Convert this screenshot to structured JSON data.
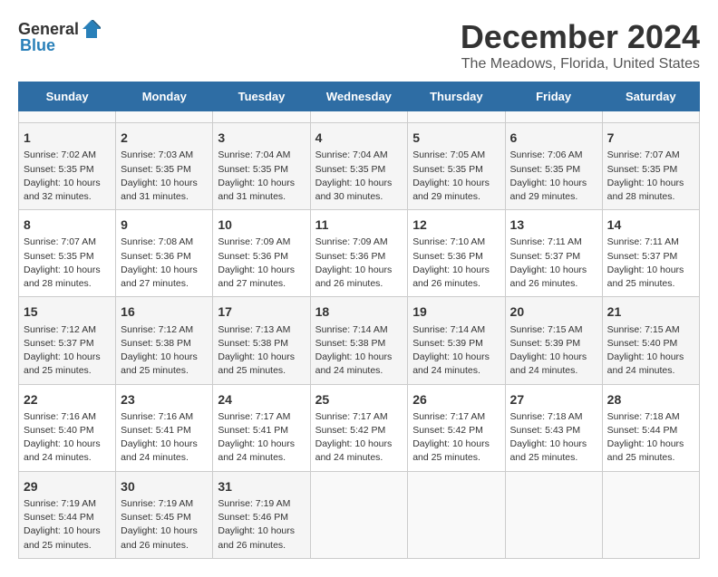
{
  "header": {
    "logo_general": "General",
    "logo_blue": "Blue",
    "title": "December 2024",
    "subtitle": "The Meadows, Florida, United States"
  },
  "calendar": {
    "days_of_week": [
      "Sunday",
      "Monday",
      "Tuesday",
      "Wednesday",
      "Thursday",
      "Friday",
      "Saturday"
    ],
    "weeks": [
      [
        {
          "day": "",
          "empty": true
        },
        {
          "day": "",
          "empty": true
        },
        {
          "day": "",
          "empty": true
        },
        {
          "day": "",
          "empty": true
        },
        {
          "day": "",
          "empty": true
        },
        {
          "day": "",
          "empty": true
        },
        {
          "day": "",
          "empty": true
        }
      ],
      [
        {
          "day": "1",
          "sunrise": "Sunrise: 7:02 AM",
          "sunset": "Sunset: 5:35 PM",
          "daylight": "Daylight: 10 hours and 32 minutes."
        },
        {
          "day": "2",
          "sunrise": "Sunrise: 7:03 AM",
          "sunset": "Sunset: 5:35 PM",
          "daylight": "Daylight: 10 hours and 31 minutes."
        },
        {
          "day": "3",
          "sunrise": "Sunrise: 7:04 AM",
          "sunset": "Sunset: 5:35 PM",
          "daylight": "Daylight: 10 hours and 31 minutes."
        },
        {
          "day": "4",
          "sunrise": "Sunrise: 7:04 AM",
          "sunset": "Sunset: 5:35 PM",
          "daylight": "Daylight: 10 hours and 30 minutes."
        },
        {
          "day": "5",
          "sunrise": "Sunrise: 7:05 AM",
          "sunset": "Sunset: 5:35 PM",
          "daylight": "Daylight: 10 hours and 29 minutes."
        },
        {
          "day": "6",
          "sunrise": "Sunrise: 7:06 AM",
          "sunset": "Sunset: 5:35 PM",
          "daylight": "Daylight: 10 hours and 29 minutes."
        },
        {
          "day": "7",
          "sunrise": "Sunrise: 7:07 AM",
          "sunset": "Sunset: 5:35 PM",
          "daylight": "Daylight: 10 hours and 28 minutes."
        }
      ],
      [
        {
          "day": "8",
          "sunrise": "Sunrise: 7:07 AM",
          "sunset": "Sunset: 5:35 PM",
          "daylight": "Daylight: 10 hours and 28 minutes."
        },
        {
          "day": "9",
          "sunrise": "Sunrise: 7:08 AM",
          "sunset": "Sunset: 5:36 PM",
          "daylight": "Daylight: 10 hours and 27 minutes."
        },
        {
          "day": "10",
          "sunrise": "Sunrise: 7:09 AM",
          "sunset": "Sunset: 5:36 PM",
          "daylight": "Daylight: 10 hours and 27 minutes."
        },
        {
          "day": "11",
          "sunrise": "Sunrise: 7:09 AM",
          "sunset": "Sunset: 5:36 PM",
          "daylight": "Daylight: 10 hours and 26 minutes."
        },
        {
          "day": "12",
          "sunrise": "Sunrise: 7:10 AM",
          "sunset": "Sunset: 5:36 PM",
          "daylight": "Daylight: 10 hours and 26 minutes."
        },
        {
          "day": "13",
          "sunrise": "Sunrise: 7:11 AM",
          "sunset": "Sunset: 5:37 PM",
          "daylight": "Daylight: 10 hours and 26 minutes."
        },
        {
          "day": "14",
          "sunrise": "Sunrise: 7:11 AM",
          "sunset": "Sunset: 5:37 PM",
          "daylight": "Daylight: 10 hours and 25 minutes."
        }
      ],
      [
        {
          "day": "15",
          "sunrise": "Sunrise: 7:12 AM",
          "sunset": "Sunset: 5:37 PM",
          "daylight": "Daylight: 10 hours and 25 minutes."
        },
        {
          "day": "16",
          "sunrise": "Sunrise: 7:12 AM",
          "sunset": "Sunset: 5:38 PM",
          "daylight": "Daylight: 10 hours and 25 minutes."
        },
        {
          "day": "17",
          "sunrise": "Sunrise: 7:13 AM",
          "sunset": "Sunset: 5:38 PM",
          "daylight": "Daylight: 10 hours and 25 minutes."
        },
        {
          "day": "18",
          "sunrise": "Sunrise: 7:14 AM",
          "sunset": "Sunset: 5:38 PM",
          "daylight": "Daylight: 10 hours and 24 minutes."
        },
        {
          "day": "19",
          "sunrise": "Sunrise: 7:14 AM",
          "sunset": "Sunset: 5:39 PM",
          "daylight": "Daylight: 10 hours and 24 minutes."
        },
        {
          "day": "20",
          "sunrise": "Sunrise: 7:15 AM",
          "sunset": "Sunset: 5:39 PM",
          "daylight": "Daylight: 10 hours and 24 minutes."
        },
        {
          "day": "21",
          "sunrise": "Sunrise: 7:15 AM",
          "sunset": "Sunset: 5:40 PM",
          "daylight": "Daylight: 10 hours and 24 minutes."
        }
      ],
      [
        {
          "day": "22",
          "sunrise": "Sunrise: 7:16 AM",
          "sunset": "Sunset: 5:40 PM",
          "daylight": "Daylight: 10 hours and 24 minutes."
        },
        {
          "day": "23",
          "sunrise": "Sunrise: 7:16 AM",
          "sunset": "Sunset: 5:41 PM",
          "daylight": "Daylight: 10 hours and 24 minutes."
        },
        {
          "day": "24",
          "sunrise": "Sunrise: 7:17 AM",
          "sunset": "Sunset: 5:41 PM",
          "daylight": "Daylight: 10 hours and 24 minutes."
        },
        {
          "day": "25",
          "sunrise": "Sunrise: 7:17 AM",
          "sunset": "Sunset: 5:42 PM",
          "daylight": "Daylight: 10 hours and 24 minutes."
        },
        {
          "day": "26",
          "sunrise": "Sunrise: 7:17 AM",
          "sunset": "Sunset: 5:42 PM",
          "daylight": "Daylight: 10 hours and 25 minutes."
        },
        {
          "day": "27",
          "sunrise": "Sunrise: 7:18 AM",
          "sunset": "Sunset: 5:43 PM",
          "daylight": "Daylight: 10 hours and 25 minutes."
        },
        {
          "day": "28",
          "sunrise": "Sunrise: 7:18 AM",
          "sunset": "Sunset: 5:44 PM",
          "daylight": "Daylight: 10 hours and 25 minutes."
        }
      ],
      [
        {
          "day": "29",
          "sunrise": "Sunrise: 7:19 AM",
          "sunset": "Sunset: 5:44 PM",
          "daylight": "Daylight: 10 hours and 25 minutes."
        },
        {
          "day": "30",
          "sunrise": "Sunrise: 7:19 AM",
          "sunset": "Sunset: 5:45 PM",
          "daylight": "Daylight: 10 hours and 26 minutes."
        },
        {
          "day": "31",
          "sunrise": "Sunrise: 7:19 AM",
          "sunset": "Sunset: 5:46 PM",
          "daylight": "Daylight: 10 hours and 26 minutes."
        },
        {
          "day": "",
          "empty": true
        },
        {
          "day": "",
          "empty": true
        },
        {
          "day": "",
          "empty": true
        },
        {
          "day": "",
          "empty": true
        }
      ]
    ]
  }
}
